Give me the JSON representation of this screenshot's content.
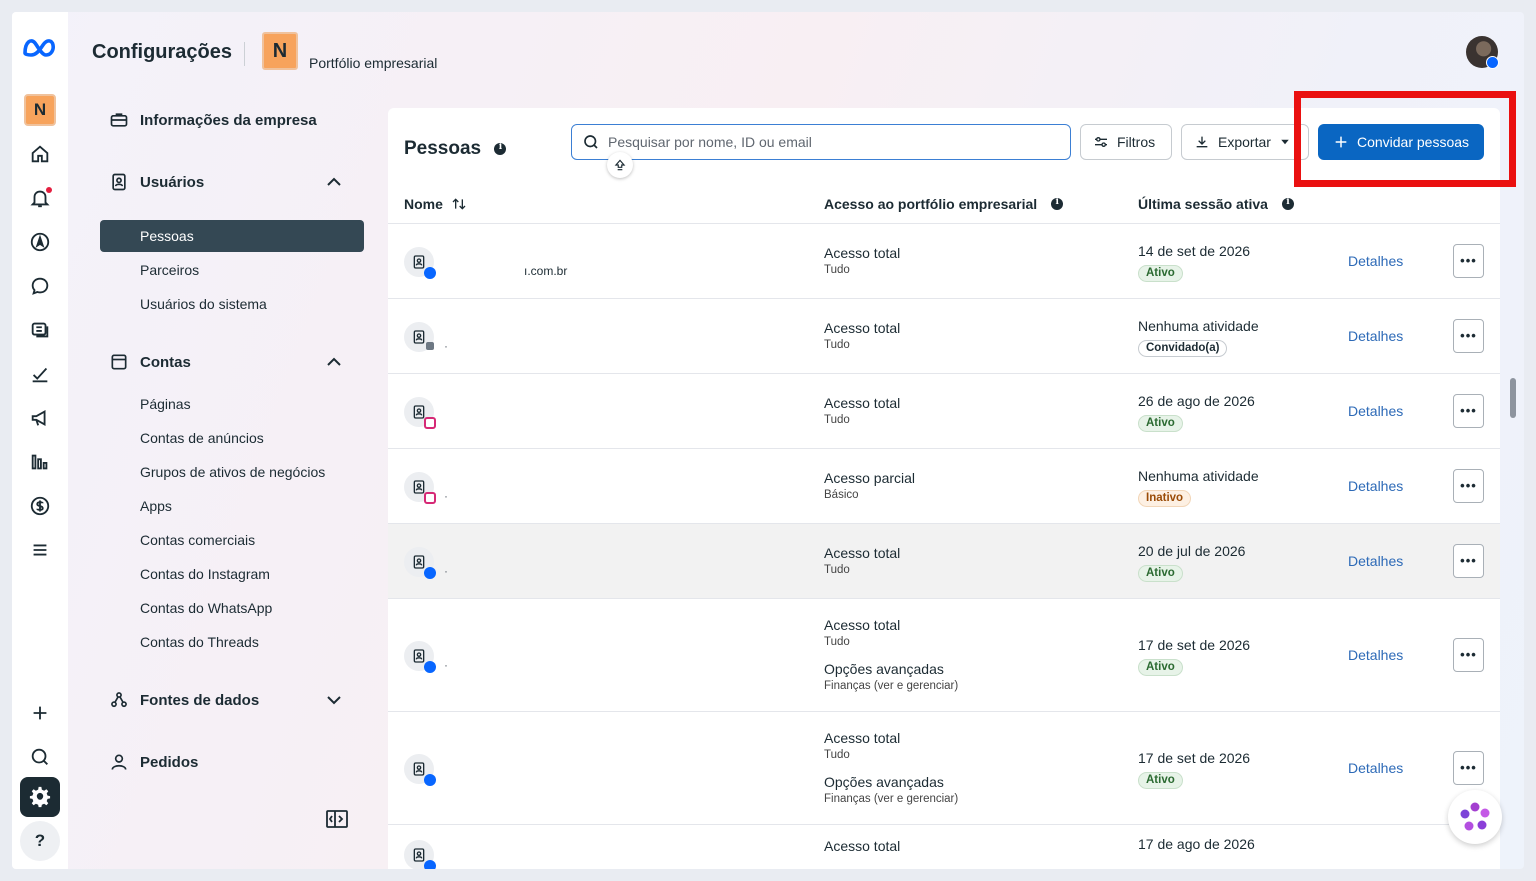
{
  "header": {
    "title": "Configurações",
    "portfolio_initial": "N",
    "portfolio_name": "Portfólio empresarial"
  },
  "rail": {
    "org_initial": "N",
    "help_label": "?",
    "icons": [
      "meta-logo",
      "home-icon",
      "bell-icon",
      "compass-icon",
      "chat-icon",
      "content-icon",
      "planner-icon",
      "megaphone-icon",
      "insights-icon",
      "dollar-icon",
      "menu-icon",
      "plus-icon",
      "search-icon",
      "gear-icon",
      "help-icon"
    ]
  },
  "nav": {
    "company_info": "Informações da empresa",
    "users": {
      "label": "Usuários",
      "items": [
        "Pessoas",
        "Parceiros",
        "Usuários do sistema"
      ]
    },
    "accounts": {
      "label": "Contas",
      "items": [
        "Páginas",
        "Contas de anúncios",
        "Grupos de ativos de negócios",
        "Apps",
        "Contas comerciais",
        "Contas do Instagram",
        "Contas do WhatsApp",
        "Contas do Threads"
      ]
    },
    "data_sources": "Fontes de dados",
    "requests": "Pedidos"
  },
  "panel": {
    "title": "Pessoas",
    "search_placeholder": "Pesquisar por nome, ID ou email",
    "filters_label": "Filtros",
    "export_label": "Exportar",
    "invite_label": "Convidar pessoas"
  },
  "table": {
    "columns": [
      "Nome",
      "Acesso ao portfólio empresarial",
      "Última sessão ativa"
    ],
    "details_label": "Detalhes",
    "more_label": "•••",
    "rows": [
      {
        "email": "ı.com.br",
        "platform": "facebook",
        "access": "Acesso total",
        "access_sub": "Tudo",
        "session": "14 de set de 2026",
        "status": "Ativo",
        "status_type": "ativo"
      },
      {
        "email": "·",
        "platform": "business",
        "access": "Acesso total",
        "access_sub": "Tudo",
        "session": "Nenhuma atividade",
        "status": "Convidado(a)",
        "status_type": "conv"
      },
      {
        "email": "",
        "platform": "instagram",
        "access": "Acesso total",
        "access_sub": "Tudo",
        "session": "26 de ago de 2026",
        "status": "Ativo",
        "status_type": "ativo"
      },
      {
        "email": "·",
        "platform": "instagram",
        "access": "Acesso parcial",
        "access_sub": "Básico",
        "session": "Nenhuma atividade",
        "status": "Inativo",
        "status_type": "inat"
      },
      {
        "email": "·",
        "platform": "facebook",
        "access": "Acesso total",
        "access_sub": "Tudo",
        "session": "20 de jul de 2026",
        "status": "Ativo",
        "status_type": "ativo"
      },
      {
        "email": "·",
        "platform": "facebook",
        "access": "Acesso total",
        "access_sub": "Tudo",
        "advanced": "Opções avançadas",
        "advanced_sub": "Finanças (ver e gerenciar)",
        "session": "17 de set de 2026",
        "status": "Ativo",
        "status_type": "ativo"
      },
      {
        "email": "",
        "platform": "facebook",
        "access": "Acesso total",
        "access_sub": "Tudo",
        "advanced": "Opções avançadas",
        "advanced_sub": "Finanças (ver e gerenciar)",
        "session": "17 de set de 2026",
        "status": "Ativo",
        "status_type": "ativo"
      },
      {
        "email": "",
        "platform": "facebook",
        "access": "Acesso total",
        "access_sub": "",
        "session": "17 de ago de 2026",
        "status": "",
        "status_type": ""
      }
    ]
  },
  "colors": {
    "primary": "#0a66c2",
    "active_nav": "#344854",
    "highlight": "#ea1010",
    "link": "#2d6ab7"
  }
}
